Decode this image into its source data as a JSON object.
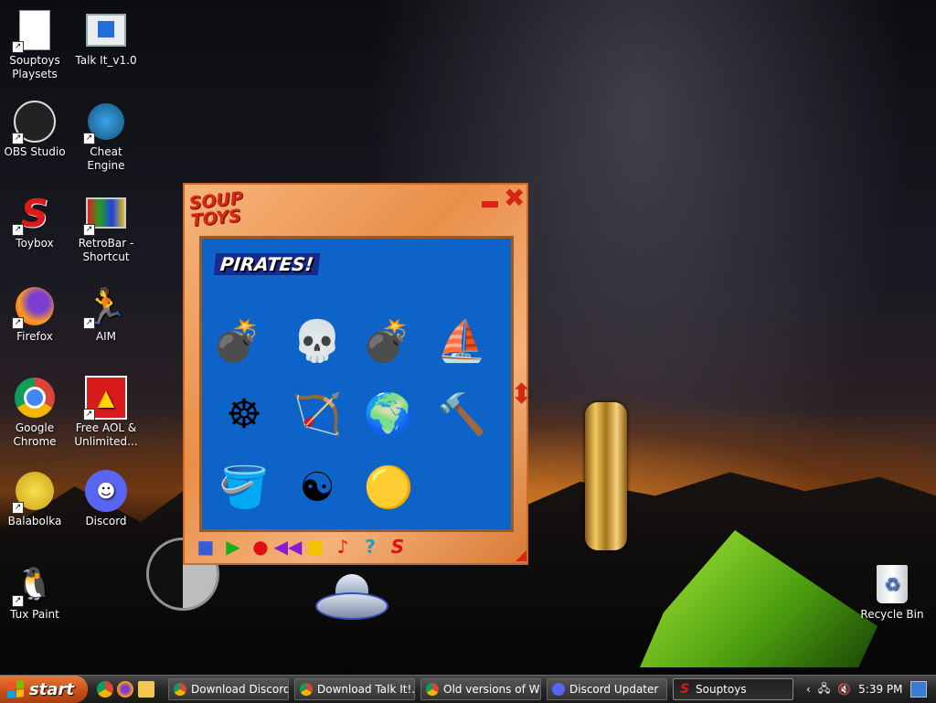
{
  "desktop": {
    "icons": [
      {
        "label": "Souptoys Playsets",
        "icon": "document-icon"
      },
      {
        "label": "Talk It_v1.0",
        "icon": "app-window-icon"
      },
      {
        "label": "OBS Studio",
        "icon": "obs-icon"
      },
      {
        "label": "Cheat Engine",
        "icon": "cheat-engine-icon"
      },
      {
        "label": "Toybox",
        "icon": "souptoys-s-icon"
      },
      {
        "label": "RetroBar - Shortcut",
        "icon": "retrobar-icon"
      },
      {
        "label": "Firefox",
        "icon": "firefox-icon"
      },
      {
        "label": "AIM",
        "icon": "aim-running-man-icon"
      },
      {
        "label": "Google Chrome",
        "icon": "chrome-icon"
      },
      {
        "label": "Free AOL & Unlimited...",
        "icon": "aol-icon"
      },
      {
        "label": "Balabolka",
        "icon": "balabolka-icon"
      },
      {
        "label": "Discord",
        "icon": "discord-icon"
      },
      {
        "label": "Tux Paint",
        "icon": "tux-paint-icon"
      },
      {
        "label": "Recycle Bin",
        "icon": "recycle-bin-icon"
      }
    ]
  },
  "souptoys": {
    "logo": "SOUP TOYS",
    "title": "PIRATES!",
    "toys": [
      {
        "name": "cannon-red-toy",
        "glyph": "💣"
      },
      {
        "name": "skull-toy",
        "glyph": "💀"
      },
      {
        "name": "cannon-green-toy",
        "glyph": "💣"
      },
      {
        "name": "pirate-ship-toy",
        "glyph": "⛵"
      },
      {
        "name": "ship-wheel-toy",
        "glyph": "☸"
      },
      {
        "name": "catapult-toy",
        "glyph": "🏹"
      },
      {
        "name": "globe-toy",
        "glyph": "🌍"
      },
      {
        "name": "mallet-toy",
        "glyph": "🔨"
      },
      {
        "name": "buckets-toy",
        "glyph": "🪣"
      },
      {
        "name": "yin-yang-toy",
        "glyph": "☯"
      },
      {
        "name": "gold-coin-toy",
        "glyph": "🟡"
      }
    ],
    "toolbar_glyphs": [
      "■",
      "▶",
      "●",
      "◀◀",
      "■",
      "♪",
      "?",
      "S"
    ],
    "colors": {
      "accent": "#d62614",
      "panel": "#0d63c7",
      "frame": "#e98f4a"
    }
  },
  "taskbar": {
    "start_label": "start",
    "tasks": [
      {
        "label": "Download Discord...",
        "icon": "chrome-icon"
      },
      {
        "label": "Download Talk It!...",
        "icon": "chrome-icon"
      },
      {
        "label": "Old versions of Wi...",
        "icon": "chrome-icon"
      },
      {
        "label": "Discord Updater",
        "icon": "discord-icon"
      },
      {
        "label": "Souptoys",
        "icon": "souptoys-s-icon"
      }
    ],
    "clock": "5:39 PM"
  }
}
